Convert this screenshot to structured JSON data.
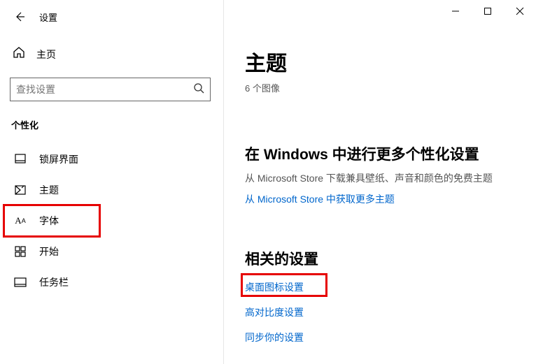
{
  "titlebar": {
    "app_title": "设置"
  },
  "sidebar": {
    "home_label": "主页",
    "search_placeholder": "查找设置",
    "section_title": "个性化",
    "items": [
      {
        "label": "锁屏界面"
      },
      {
        "label": "主题"
      },
      {
        "label": "字体"
      },
      {
        "label": "开始"
      },
      {
        "label": "任务栏"
      }
    ]
  },
  "main": {
    "page_title": "主题",
    "page_sub": "6 个图像",
    "more_heading": "在 Windows 中进行更多个性化设置",
    "more_text": "从 Microsoft Store 下载兼具壁纸、声音和颜色的免费主题",
    "store_link": "从 Microsoft Store 中获取更多主题",
    "related_heading": "相关的设置",
    "related_links": [
      "桌面图标设置",
      "高对比度设置",
      "同步你的设置"
    ]
  }
}
